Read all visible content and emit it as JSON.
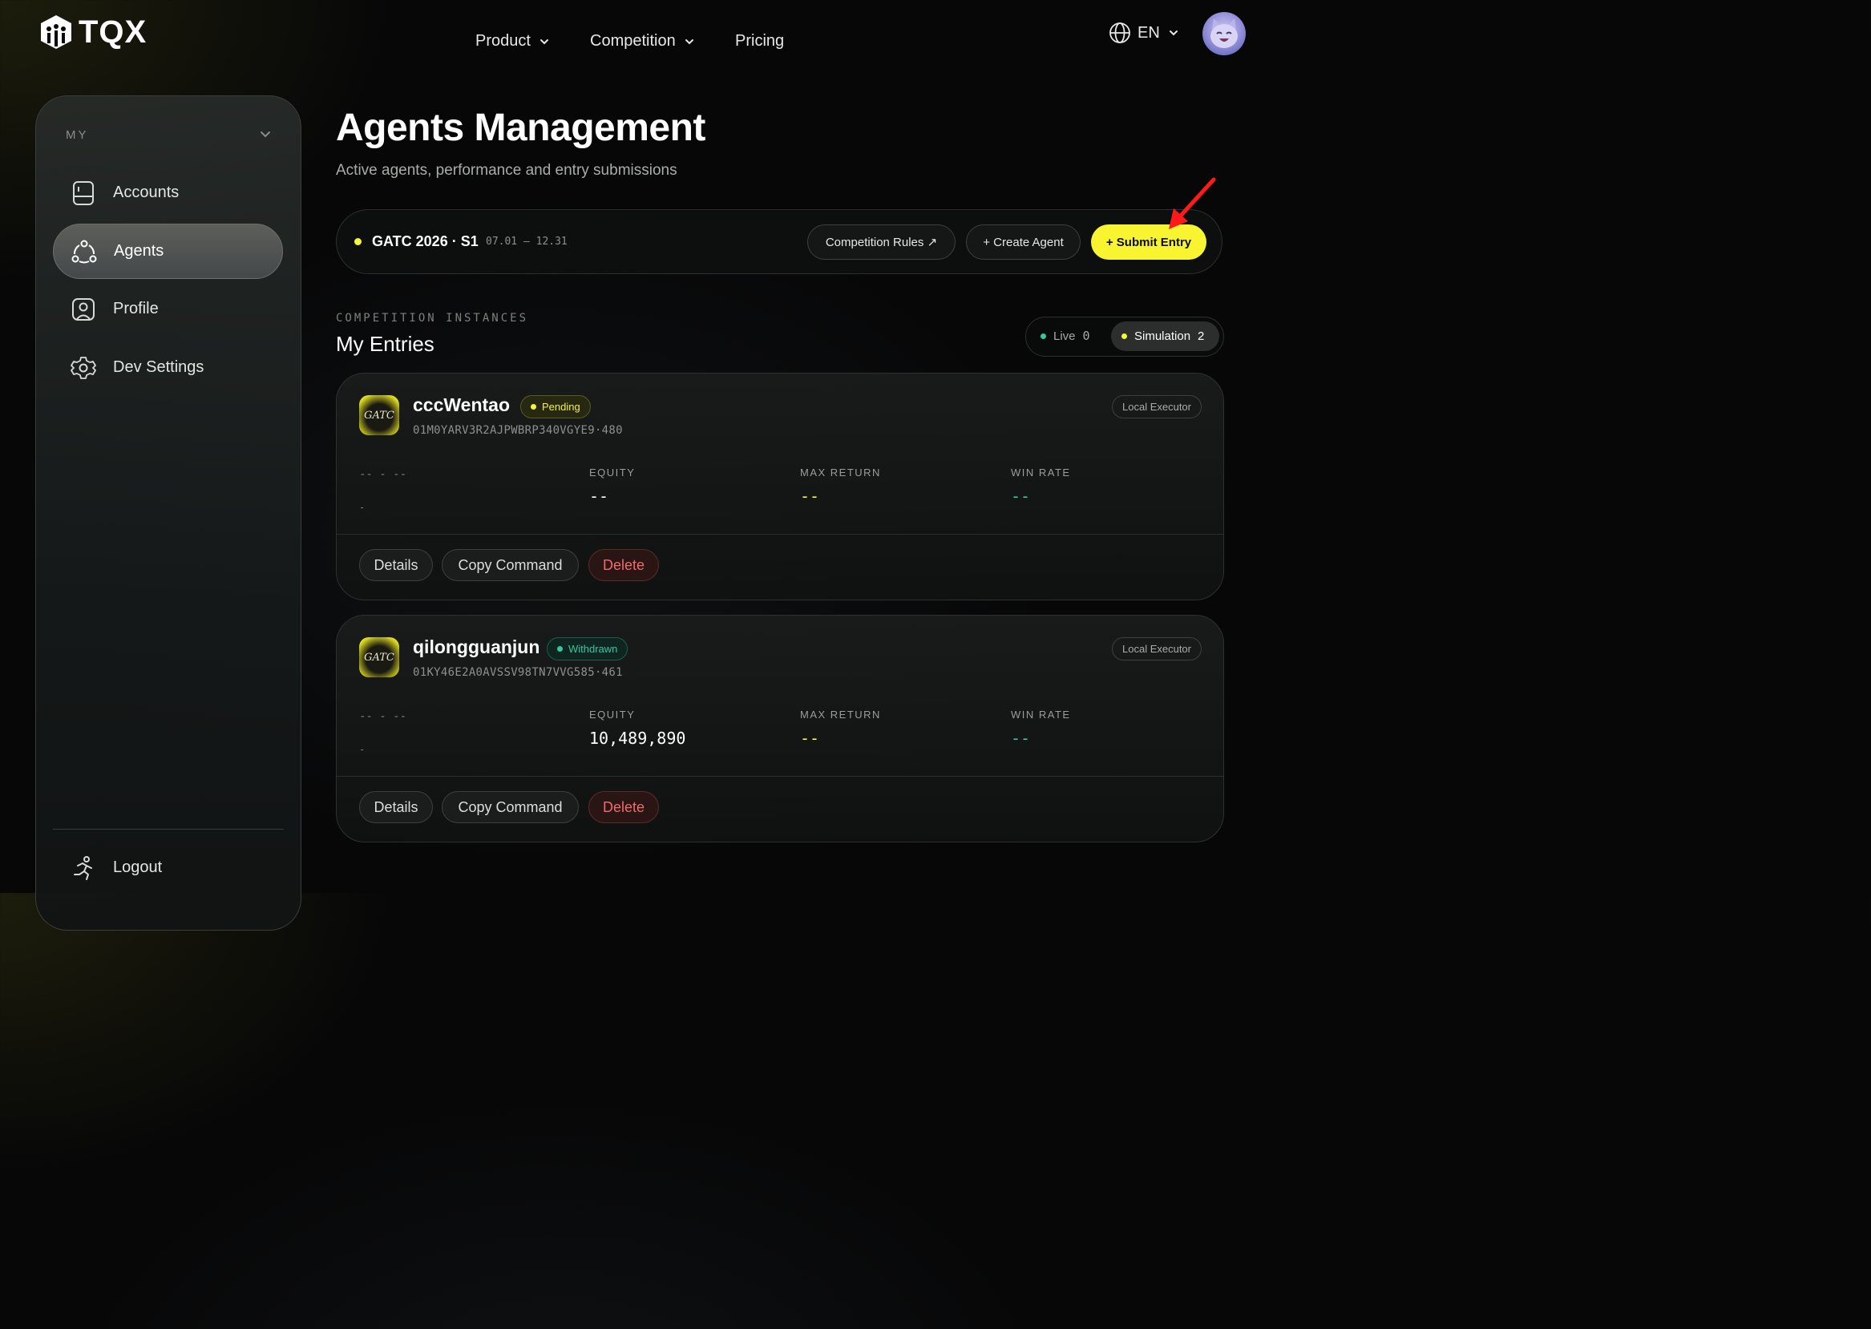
{
  "header": {
    "brand": "TQX",
    "nav": [
      {
        "label": "Product",
        "has_dropdown": true
      },
      {
        "label": "Competition",
        "has_dropdown": true
      },
      {
        "label": "Pricing",
        "has_dropdown": false
      }
    ],
    "language": "EN"
  },
  "sidebar": {
    "section_label": "MY",
    "items": [
      {
        "label": "Accounts",
        "icon": "accounts-icon",
        "active": false
      },
      {
        "label": "Agents",
        "icon": "agents-icon",
        "active": true
      },
      {
        "label": "Profile",
        "icon": "profile-icon",
        "active": false
      },
      {
        "label": "Dev Settings",
        "icon": "gear-icon",
        "active": false
      }
    ],
    "logout_label": "Logout"
  },
  "page": {
    "title": "Agents Management",
    "subtitle": "Active agents, performance and entry submissions"
  },
  "competition": {
    "name": "GATC 2026 · S1",
    "dates": "07.01 — 12.31",
    "rules_button": "Competition Rules ↗",
    "create_button": "+ Create Agent",
    "submit_button": "+ Submit Entry"
  },
  "entries_section": {
    "label": "COMPETITION INSTANCES",
    "title": "My Entries",
    "toggle": {
      "live_label": "Live",
      "live_count": "0",
      "sim_label": "Simulation",
      "sim_count": "2"
    }
  },
  "entries": [
    {
      "logo_text": "GATC",
      "name": "cccWentao",
      "status": "Pending",
      "id": "01M0YARV3R2AJPWBRP340VGYE9·480",
      "executor": "Local Executor",
      "placeholder_top": "-- - --",
      "placeholder_bottom": "-",
      "stats": {
        "equity_label": "EQUITY",
        "equity": "--",
        "max_return_label": "MAX RETURN",
        "max_return": "--",
        "win_rate_label": "WIN RATE",
        "win_rate": "--"
      },
      "actions": {
        "details": "Details",
        "copy": "Copy Command",
        "delete": "Delete"
      }
    },
    {
      "logo_text": "GATC",
      "name": "qilongguanjun",
      "status": "Withdrawn",
      "id": "01KY46E2A0AVSSV98TN7VVG585·461",
      "executor": "Local Executor",
      "placeholder_top": "-- - --",
      "placeholder_bottom": "-",
      "stats": {
        "equity_label": "EQUITY",
        "equity": "10,489,890",
        "max_return_label": "MAX RETURN",
        "max_return": "--",
        "win_rate_label": "WIN RATE",
        "win_rate": "--"
      },
      "actions": {
        "details": "Details",
        "copy": "Copy Command",
        "delete": "Delete"
      }
    }
  ],
  "colors": {
    "accent_yellow": "#f8f530",
    "teal": "#34c8a0",
    "danger": "#f06a6a"
  }
}
